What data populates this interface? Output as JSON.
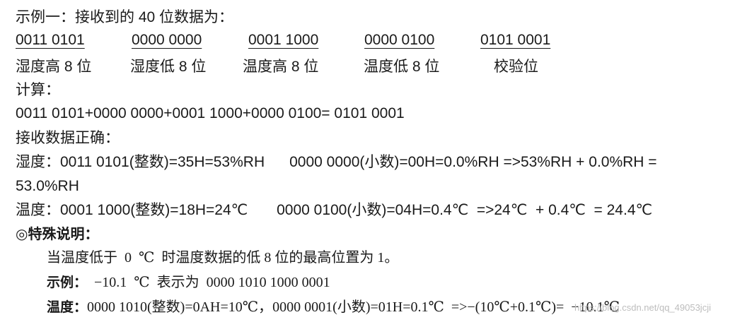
{
  "heading": "示例一：接收到的 40 位数据为：",
  "bit_groups": [
    {
      "bits": "0011 0101",
      "label": "湿度高 8 位"
    },
    {
      "bits": "0000 0000",
      "label": "湿度低 8 位"
    },
    {
      "bits": "0001 1000",
      "label": "温度高 8 位"
    },
    {
      "bits": "0000 0100",
      "label": "温度低 8 位"
    },
    {
      "bits": "0101 0001",
      "label": "校验位"
    }
  ],
  "calc_label": "计算：",
  "calc_formula": "0011 0101+0000 0000+0001 1000+0000 0100= 0101 0001",
  "correct_label": "接收数据正确：",
  "humidity_line1": "湿度：0011 0101(整数)=35H=53%RH      0000 0000(小数)=00H=0.0%RH =>53%RH + 0.0%RH =",
  "humidity_line2": "53.0%RH",
  "temperature_line": "温度：0001 1000(整数)=18H=24℃       0000 0100(小数)=04H=0.4℃  =>24℃  + 0.4℃  = 24.4℃",
  "special": {
    "title": "◎特殊说明：",
    "rule": "当温度低于  0  ℃  时温度数据的低 8 位的最高位置为 1。",
    "example_label": "示例：",
    "example_text": "  −10.1  ℃  表示为  0000 1010 1000 0001",
    "temp_label": "温度：",
    "temp_text": "0000 1010(整数)=0AH=10℃，0000 0001(小数)=01H=0.1℃  =>−(10℃+0.1℃)=  −10.1℃"
  },
  "watermark": "https://blog.csdn.net/qq_49053jcji"
}
